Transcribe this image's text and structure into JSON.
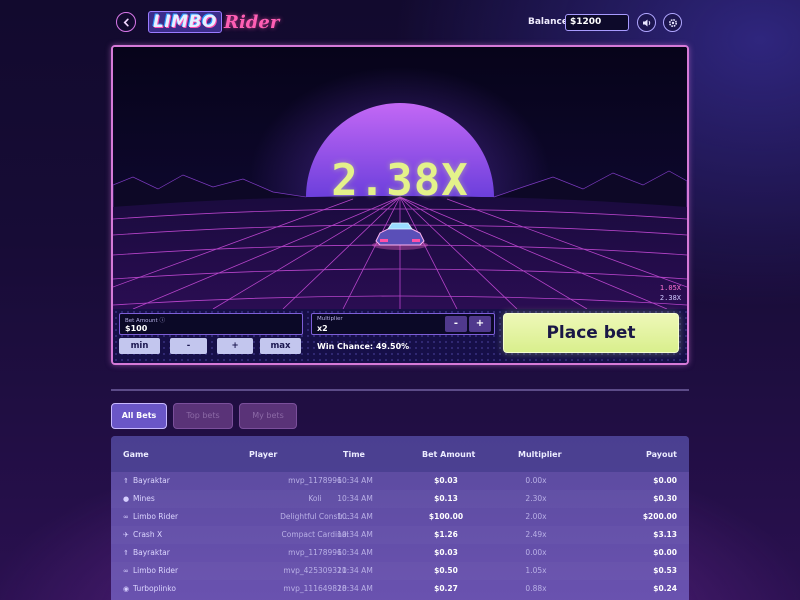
{
  "header": {
    "logo_primary": "LIMBO",
    "logo_secondary": "Rider",
    "balance_label": "Balance:",
    "balance_value": "$1200"
  },
  "game": {
    "current_multiplier": "2.38X",
    "history": [
      "1.05X",
      "2.38X"
    ],
    "colors": {
      "sun_top": "#c368f5",
      "sun_bottom": "#6c3fdc",
      "grid": "#c64ad8",
      "multiplier": "#e4f28a"
    }
  },
  "controls": {
    "bet_amount_label": "Bet Amount",
    "bet_amount_value": "$100",
    "multiplier_label": "Multiplier",
    "multiplier_value": "x2",
    "minus_label": "-",
    "plus_label": "+",
    "chip_min": "min",
    "chip_minus": "-",
    "chip_plus": "+",
    "chip_max": "max",
    "win_chance": "Win Chance: 49.50%",
    "place_bet_label": "Place bet"
  },
  "tabs": [
    {
      "label": "All Bets",
      "active": true
    },
    {
      "label": "Top bets",
      "active": false
    },
    {
      "label": "My bets",
      "active": false
    }
  ],
  "table": {
    "headers": {
      "game": "Game",
      "player": "Player",
      "time": "Time",
      "bet_amount": "Bet Amount",
      "multiplier": "Multiplier",
      "payout": "Payout"
    },
    "rows": [
      {
        "icon": "rocket-icon",
        "game": "Bayraktar",
        "player": "mvp_1178996",
        "time": "10:34 AM",
        "bet": "$0.03",
        "multiplier": "0.00x",
        "payout": "$0.00"
      },
      {
        "icon": "bomb-icon",
        "game": "Mines",
        "player": "Koli",
        "time": "10:34 AM",
        "bet": "$0.13",
        "multiplier": "2.30x",
        "payout": "$0.30"
      },
      {
        "icon": "car-icon",
        "game": "Limbo Rider",
        "player": "Delightful Constr...",
        "time": "10:34 AM",
        "bet": "$100.00",
        "multiplier": "2.00x",
        "payout": "$200.00"
      },
      {
        "icon": "plane-icon",
        "game": "Crash X",
        "player": "Compact Cardinal",
        "time": "10:34 AM",
        "bet": "$1.26",
        "multiplier": "2.49x",
        "payout": "$3.13"
      },
      {
        "icon": "rocket-icon",
        "game": "Bayraktar",
        "player": "mvp_1178996",
        "time": "10:34 AM",
        "bet": "$0.03",
        "multiplier": "0.00x",
        "payout": "$0.00"
      },
      {
        "icon": "car-icon",
        "game": "Limbo Rider",
        "player": "mvp_425309321",
        "time": "10:34 AM",
        "bet": "$0.50",
        "multiplier": "1.05x",
        "payout": "$0.53"
      },
      {
        "icon": "plinko-icon",
        "game": "Turboplinko",
        "player": "mvp_111649828",
        "time": "10:34 AM",
        "bet": "$0.27",
        "multiplier": "0.88x",
        "payout": "$0.24"
      }
    ]
  }
}
